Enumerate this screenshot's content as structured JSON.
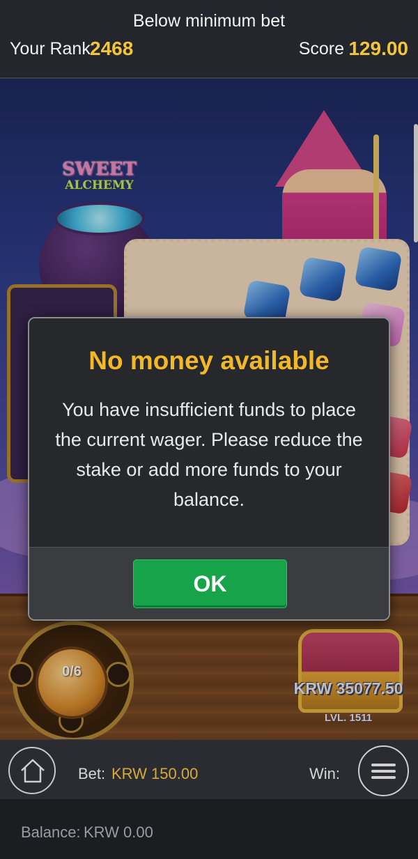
{
  "header": {
    "message": "Below minimum bet",
    "rank_label": "Your Rank",
    "rank_value": "2468",
    "score_label": "Score",
    "score_value": "129.00"
  },
  "game": {
    "logo_line1": "SWEET",
    "logo_line2": "ALCHEMY",
    "bonus_progress": "0/6",
    "chest_amount": "KRW 35077.50",
    "chest_level": "LVL. 1511"
  },
  "dialog": {
    "title": "No money available",
    "body": "You have insufficient funds to place the current wager. Please reduce the stake or add more funds to your balance.",
    "ok_label": "OK"
  },
  "footer": {
    "bet_label": "Bet:",
    "bet_value": "KRW 150.00",
    "win_label": "Win:",
    "balance_label": "Balance:",
    "balance_value": "KRW 0.00"
  },
  "colors": {
    "accent_gold": "#f3b72a",
    "ok_green": "#16a34a",
    "bet_gold": "#d9a93a"
  },
  "icons": {
    "home": "home-icon",
    "menu": "hamburger-menu-icon"
  }
}
